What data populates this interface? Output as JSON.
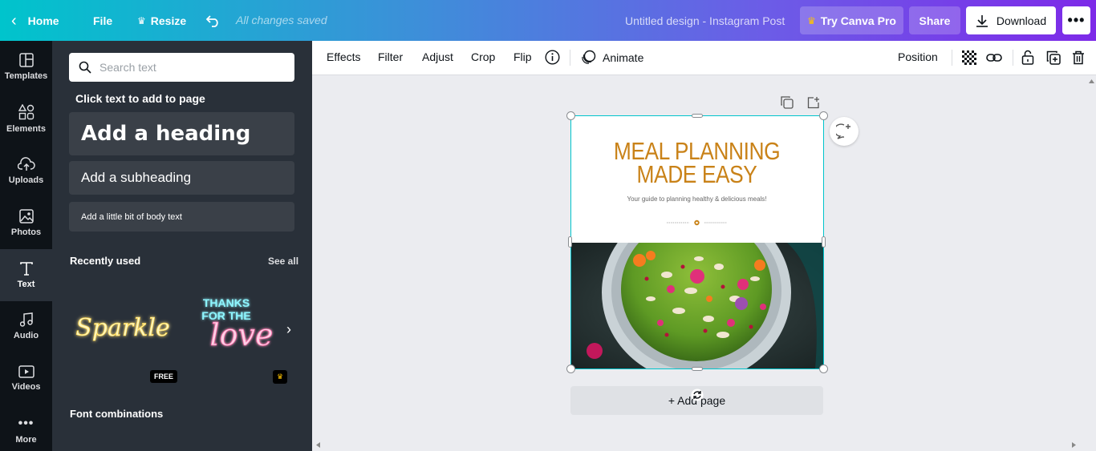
{
  "topbar": {
    "home": "Home",
    "file": "File",
    "resize": "Resize",
    "saved_status": "All changes saved",
    "design_title": "Untitled design - Instagram Post",
    "try_pro": "Try Canva Pro",
    "share": "Share",
    "download": "Download",
    "more": "•••"
  },
  "rail": {
    "items": [
      {
        "label": "Templates",
        "icon": "templates-icon"
      },
      {
        "label": "Elements",
        "icon": "elements-icon"
      },
      {
        "label": "Uploads",
        "icon": "uploads-icon"
      },
      {
        "label": "Photos",
        "icon": "photos-icon"
      },
      {
        "label": "Text",
        "icon": "text-icon",
        "active": true
      },
      {
        "label": "Audio",
        "icon": "audio-icon"
      },
      {
        "label": "Videos",
        "icon": "videos-icon"
      },
      {
        "label": "More",
        "icon": "more-icon"
      }
    ]
  },
  "panel": {
    "search_placeholder": "Search text",
    "click_text": "Click text to add to page",
    "add_heading": "Add a heading",
    "add_subheading": "Add a subheading",
    "add_body": "Add a little bit of body text",
    "recently_used": "Recently used",
    "see_all": "See all",
    "recent_tiles": [
      {
        "text": "Sparkle",
        "badge": "FREE"
      },
      {
        "line1": "THANKS",
        "line2": "FOR THE",
        "line3": "love",
        "badge": "crown"
      }
    ],
    "font_combinations": "Font combinations"
  },
  "edit_bar": {
    "effects": "Effects",
    "filter": "Filter",
    "adjust": "Adjust",
    "crop": "Crop",
    "flip": "Flip",
    "animate": "Animate",
    "position": "Position"
  },
  "design": {
    "title_line1": "MEAL PLANNING",
    "title_line2": "MADE EASY",
    "subtitle": "Your guide to planning healthy & delicious meals!",
    "accent_color": "#c98218"
  },
  "canvas": {
    "add_page": "+ Add page"
  }
}
